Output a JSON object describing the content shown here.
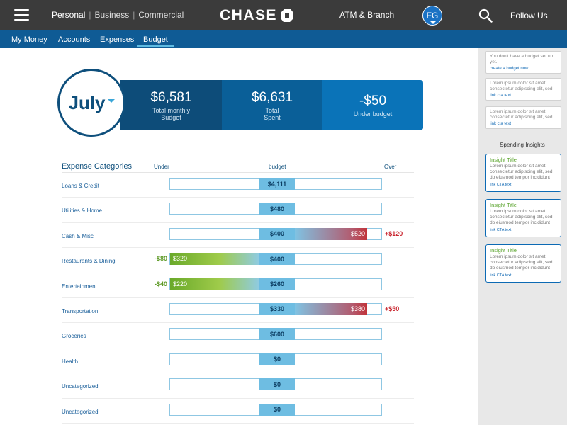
{
  "header": {
    "segments": [
      "Personal",
      "Business",
      "Commercial"
    ],
    "logo": "CHASE",
    "atm_label": "ATM & Branch",
    "avatar_initials": "FG",
    "follow_label": "Follow Us"
  },
  "subnav": {
    "tabs": [
      "My Money",
      "Accounts",
      "Expenses",
      "Budget"
    ],
    "active_tab": "Budget"
  },
  "summary": {
    "month": "July",
    "cells": [
      {
        "value": "$6,581",
        "label1": "Total monthly",
        "label2": "Budget"
      },
      {
        "value": "$6,631",
        "label1": "Total",
        "label2": "Spent"
      },
      {
        "value": "-$50",
        "label1": "Under budget",
        "label2": ""
      }
    ]
  },
  "categories": {
    "title": "Expense Categories",
    "col_under": "Under",
    "col_budget": "budget",
    "col_over": "Over",
    "rows": [
      {
        "name": "Loans & Credit",
        "budget": "$4,111",
        "status": "on"
      },
      {
        "name": "Utilities & Home",
        "budget": "$480",
        "status": "on"
      },
      {
        "name": "Cash & Misc",
        "budget": "$400",
        "status": "over",
        "spent": "$520",
        "diff": "+$120",
        "fill": 0.82
      },
      {
        "name": "Restaurants & Dining",
        "budget": "$400",
        "status": "under",
        "spent": "$320",
        "diff": "-$80",
        "fill": 1.0
      },
      {
        "name": "Entertainment",
        "budget": "$260",
        "status": "under",
        "spent": "$220",
        "diff": "-$40",
        "fill": 1.0
      },
      {
        "name": "Transportation",
        "budget": "$330",
        "status": "over",
        "spent": "$380",
        "diff": "+$50",
        "fill": 0.82
      },
      {
        "name": "Groceries",
        "budget": "$600",
        "status": "on"
      },
      {
        "name": "Health",
        "budget": "$0",
        "status": "on"
      },
      {
        "name": "Uncategorized",
        "budget": "$0",
        "status": "on"
      },
      {
        "name": "Uncategorized",
        "budget": "$0",
        "status": "on"
      }
    ]
  },
  "sidebar": {
    "tips": [
      {
        "text": "You don't have a budget set up yet.",
        "link": "create a budget now"
      },
      {
        "text": "Lorem ipsum dolor sit amet, consectetur adipiscing elit, sed",
        "link": "link cta text"
      },
      {
        "text": "Lorem ipsum dolor sit amet, consectetur adipiscing elit, sed",
        "link": "link cta text"
      }
    ],
    "insights_heading": "Spending Insights",
    "insights": [
      {
        "title": "Insight Title",
        "body": "Lorem ipsum dolor sit amet, consectetur adipiscing elit, sed do eiusmod tempor incididunt",
        "link": "link CTA text"
      },
      {
        "title": "Insight Title",
        "body": "Lorem ipsum dolor sit amet, consectetur adipiscing elit, sed do eiusmod tempor incididunt",
        "link": "link CTA text"
      },
      {
        "title": "Insight Title",
        "body": "Lorem ipsum dolor sit amet, consectetur adipiscing elit, sed do eiusmod tempor incididunt",
        "link": "link CTA text"
      }
    ]
  }
}
